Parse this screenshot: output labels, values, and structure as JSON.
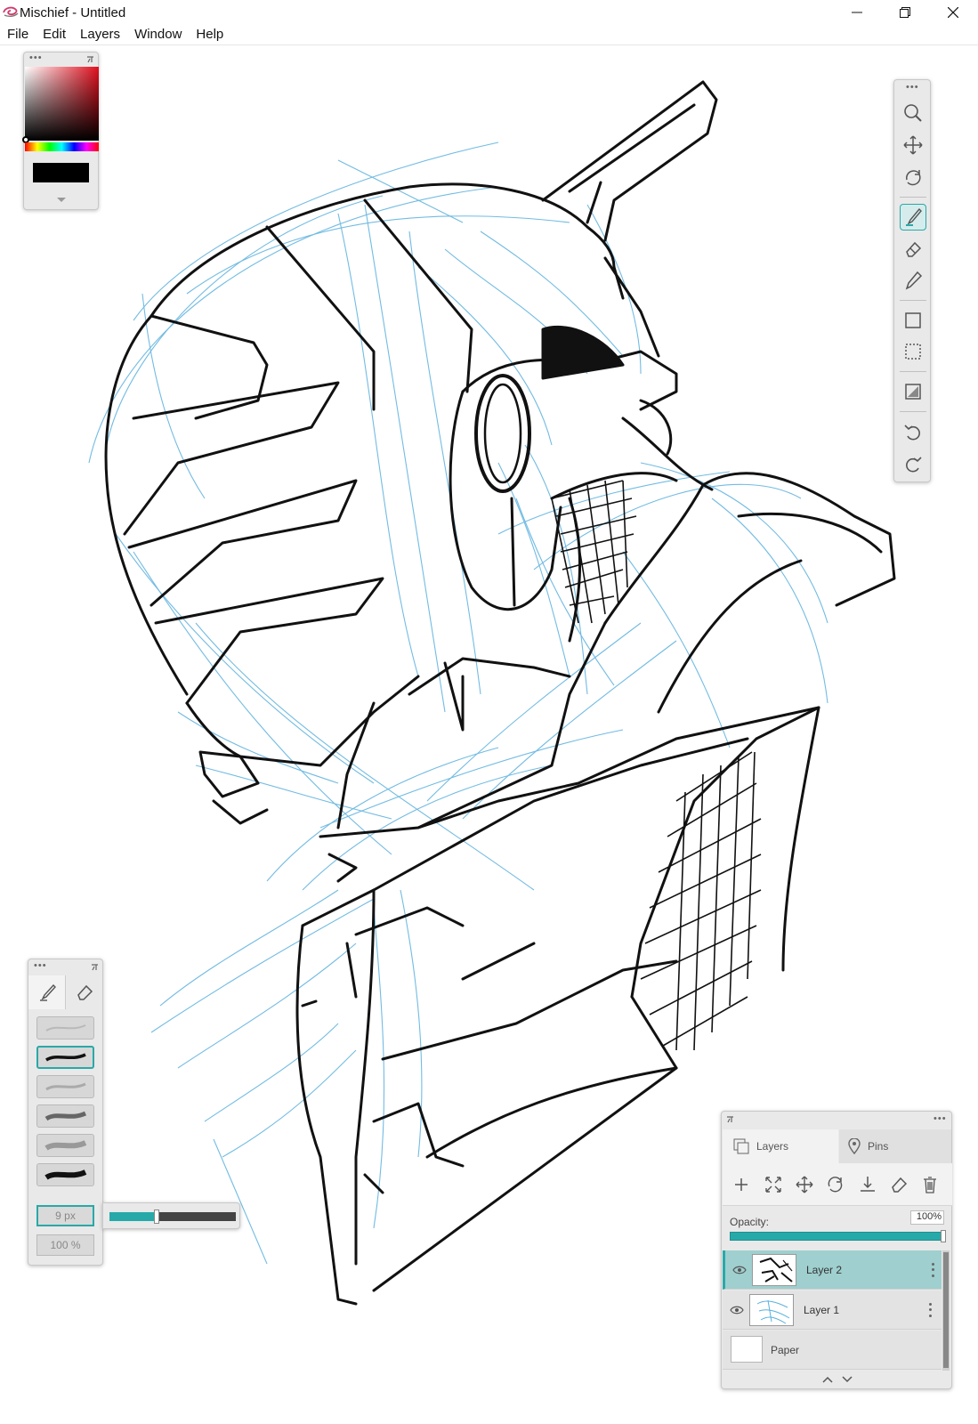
{
  "window": {
    "title": "Mischief - Untitled"
  },
  "menu": {
    "items": [
      "File",
      "Edit",
      "Layers",
      "Window",
      "Help"
    ]
  },
  "colors": {
    "accent": "#2aa8a8",
    "current_color": "#000000",
    "sketch_blue": "#5ab0de",
    "ink": "#111111"
  },
  "tools": [
    {
      "name": "zoom",
      "icon": "magnifier-icon"
    },
    {
      "name": "pan",
      "icon": "move-arrows-icon"
    },
    {
      "name": "rotate",
      "icon": "rotate-canvas-icon"
    },
    {
      "name": "brush",
      "icon": "brush-icon",
      "active": true
    },
    {
      "name": "eraser",
      "icon": "eraser-icon"
    },
    {
      "name": "eyedropper",
      "icon": "eyedropper-icon"
    },
    {
      "name": "rectangle",
      "icon": "rectangle-icon"
    },
    {
      "name": "selection",
      "icon": "selection-icon"
    },
    {
      "name": "fill",
      "icon": "fill-icon"
    },
    {
      "name": "undo",
      "icon": "undo-icon"
    },
    {
      "name": "redo",
      "icon": "redo-icon"
    }
  ],
  "brush_panel": {
    "tabs": [
      "brush-icon",
      "eraser-icon"
    ],
    "presets": 6,
    "active_preset": 2,
    "size": "9 px",
    "opacity": "100 %",
    "size_slider_fraction": 0.37
  },
  "layers_panel": {
    "tabs": {
      "layers": "Layers",
      "pins": "Pins"
    },
    "tools": [
      "add-layer-icon",
      "fit-icon",
      "move-layer-icon",
      "transform-icon",
      "merge-down-icon",
      "clear-icon",
      "delete-icon"
    ],
    "opacity_label": "Opacity:",
    "opacity_value": "100%",
    "opacity_fraction": 1.0,
    "layers": [
      {
        "name": "Layer 2",
        "active": true,
        "visible": true
      },
      {
        "name": "Layer 1",
        "active": false,
        "visible": true
      }
    ],
    "paper": "Paper"
  }
}
